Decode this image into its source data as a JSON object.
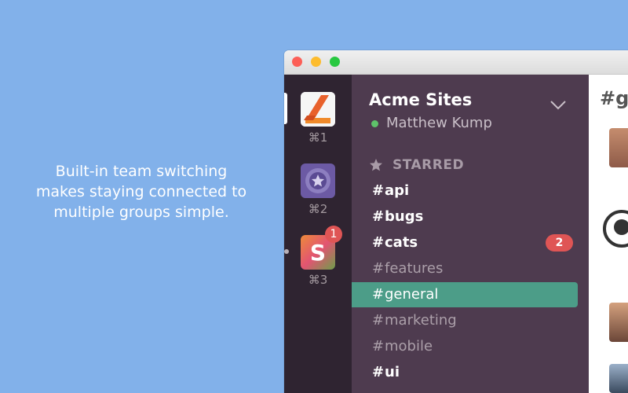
{
  "promo": {
    "lines": [
      "Built-in team switching",
      "makes staying connected to",
      "multiple groups simple."
    ]
  },
  "teams": [
    {
      "shortcut": "⌘1",
      "icon": "acme-logo-icon"
    },
    {
      "shortcut": "⌘2",
      "icon": "star-shield-icon"
    },
    {
      "shortcut": "⌘3",
      "icon": "slack-s-icon",
      "badge": "1"
    }
  ],
  "workspace": {
    "team_name": "Acme Sites",
    "user_name": "Matthew Kump",
    "starred_label": "STARRED"
  },
  "channels": [
    {
      "name": "api",
      "state": "unread"
    },
    {
      "name": "bugs",
      "state": "unread"
    },
    {
      "name": "cats",
      "state": "unread",
      "badge": "2"
    },
    {
      "name": "features",
      "state": "read"
    },
    {
      "name": "general",
      "state": "active"
    },
    {
      "name": "marketing",
      "state": "read"
    },
    {
      "name": "mobile",
      "state": "read"
    },
    {
      "name": "ui",
      "state": "unread"
    }
  ],
  "hash_symbol": "#",
  "chat": {
    "title_partial": "#g"
  },
  "colors": {
    "background": "#82b1ea",
    "sidebar": "#4e3b4f",
    "team_rail": "#2f2431",
    "active_channel": "#4c9d88",
    "badge": "#df5555",
    "presence": "#5ec26a"
  }
}
